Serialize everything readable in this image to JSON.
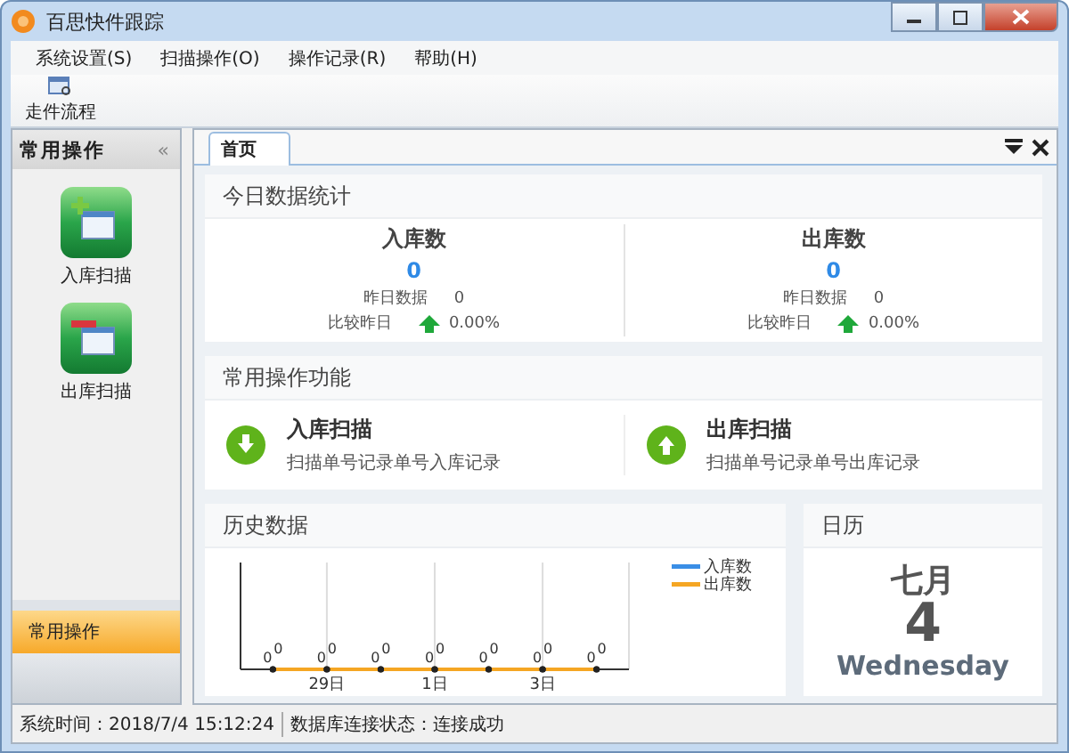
{
  "window": {
    "title": "百思快件跟踪"
  },
  "menu": [
    "系统设置(S)",
    "扫描操作(O)",
    "操作记录(R)",
    "帮助(H)"
  ],
  "toolbar": [
    {
      "label": "走件流程"
    }
  ],
  "sidebar": {
    "title": "常用操作",
    "collapse": "«",
    "items": [
      {
        "label": "入库扫描",
        "kind": "in"
      },
      {
        "label": "出库扫描",
        "kind": "out"
      }
    ],
    "sections": [
      {
        "label": "常用操作",
        "selected": true
      }
    ]
  },
  "tabs": [
    {
      "label": "首页",
      "selected": true
    }
  ],
  "today_stats": {
    "title": "今日数据统计",
    "columns": [
      {
        "heading": "入库数",
        "value": "0",
        "rows": [
          {
            "kind": "plain",
            "label": "昨日数据",
            "value": "0"
          },
          {
            "kind": "trend",
            "label": "比较昨日",
            "value": "0.00%"
          }
        ]
      },
      {
        "heading": "出库数",
        "value": "0",
        "rows": [
          {
            "kind": "plain",
            "label": "昨日数据",
            "value": "0"
          },
          {
            "kind": "trend",
            "label": "比较昨日",
            "value": "0.00%"
          }
        ]
      }
    ]
  },
  "shortcuts": {
    "title": "常用操作功能",
    "items": [
      {
        "kind": "in",
        "title": "入库扫描",
        "description": "扫描单号记录单号入库记录"
      },
      {
        "kind": "out",
        "title": "出库扫描",
        "description": "扫描单号记录单号出库记录"
      }
    ]
  },
  "history": {
    "title": "历史数据",
    "chart": {
      "x_labels": [
        "29日",
        "1日",
        "3日"
      ],
      "series": [
        {
          "name": "入库数",
          "color": "#3a8ee6",
          "point_labels": [
            "0",
            "0",
            "0",
            "0",
            "0",
            "0",
            "0"
          ]
        },
        {
          "name": "出库数",
          "color": "#f5a623",
          "point_labels": [
            "0",
            "0",
            "0",
            "0",
            "0",
            "0",
            "0"
          ]
        }
      ]
    }
  },
  "calendar": {
    "title": "日历",
    "month": "七月",
    "day": "4",
    "weekday": "Wednesday"
  },
  "status_bar": [
    "系统时间：2018/7/4 15:12:24",
    "数据库连接状态：连接成功"
  ]
}
